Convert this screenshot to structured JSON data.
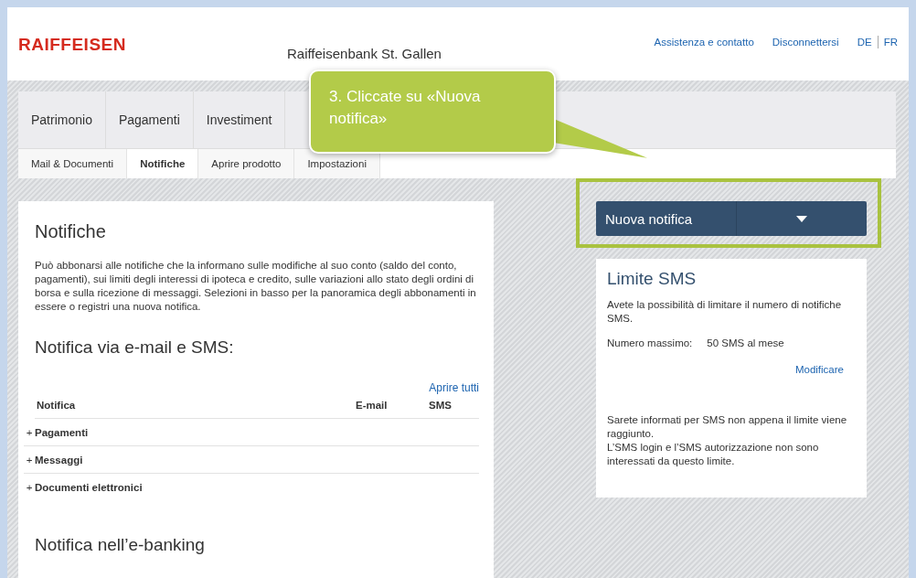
{
  "header": {
    "logo": "RAIFFEISEN",
    "bank_name": "Raiffeisenbank St. Gallen",
    "links": [
      "Assistenza e contatto",
      "Disconnettersi"
    ],
    "languages": [
      "DE",
      "FR"
    ]
  },
  "main_nav": [
    {
      "label": "Patrimonio",
      "selected": false
    },
    {
      "label": "Pagamenti",
      "selected": false
    },
    {
      "label": "Investiment",
      "selected": false
    }
  ],
  "sub_nav": [
    {
      "label": "Mail & Documenti",
      "selected": false
    },
    {
      "label": "Notifiche",
      "selected": true
    },
    {
      "label": "Aprire prodotto",
      "selected": false
    },
    {
      "label": "Impostazioni",
      "selected": false
    }
  ],
  "callout": "3. Cliccate su «Nuova notifica»",
  "content": {
    "title": "Notifiche",
    "intro": "Può abbonarsi alle notifiche che la informano sulle modifiche al suo conto (saldo del conto, pagamenti), sui limiti degli interessi di ipoteca e credito, sulle variazioni allo stato degli ordini di borsa e sulla ricezione di messaggi. Selezioni in basso per la panoramica degli abbonamenti in essere o registri una nuova notifica.",
    "section_title": "Notifica via e-mail e SMS:",
    "open_all": "Aprire tutti",
    "table": {
      "columns": [
        "Notifica",
        "E-mail",
        "SMS"
      ],
      "rows": [
        {
          "toggle": "+",
          "label": "Pagamenti",
          "expanded": false
        },
        {
          "toggle": "+",
          "label": "Messaggi",
          "expanded": false
        },
        {
          "toggle": "+",
          "label": "Documenti elettronici",
          "expanded": false
        }
      ]
    },
    "section2_title": "Notifica nell’e-banking"
  },
  "new_button": "Nuova notifica",
  "sms_card": {
    "title": "Limite SMS",
    "text": "Avete la possibilità di limitare il numero di notifiche SMS.",
    "max_label": "Numero massimo:",
    "max_value": "50 SMS al mese",
    "edit_link": "Modificare",
    "note": "Sarete informati per SMS non appena il limite viene raggiunto.\nL’SMS login e l’SMS autorizzazione non sono interessati da questo limite."
  }
}
